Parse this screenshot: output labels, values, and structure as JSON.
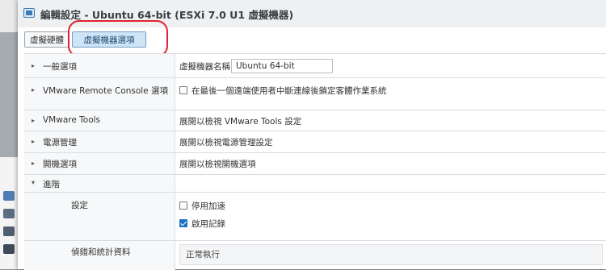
{
  "dialog": {
    "title": "編輯設定 - Ubuntu 64-bit (ESXi 7.0 U1 虛擬機器)",
    "tabs": [
      {
        "label": "虛擬硬體",
        "active": false
      },
      {
        "label": "虛擬機器選項",
        "active": true
      }
    ]
  },
  "rows": {
    "general": {
      "label": "一般選項",
      "name_label": "虛擬機器名稱:",
      "name_value": "Ubuntu 64-bit"
    },
    "vmrc": {
      "label": "VMware Remote Console 選項",
      "checkbox_label": "在最後一個遠端使用者中斷連線後鎖定客體作業系統",
      "checked": false
    },
    "tools": {
      "label": "VMware Tools",
      "value": "展開以檢視 VMware Tools 設定"
    },
    "power": {
      "label": "電源管理",
      "value": "展開以檢視電源管理設定"
    },
    "boot": {
      "label": "開機選項",
      "value": "展開以檢視開機選項"
    },
    "advanced": {
      "label": "進階",
      "settings_label": "設定",
      "options": [
        {
          "label": "停用加速",
          "checked": false
        },
        {
          "label": "啟用記錄",
          "checked": true
        }
      ],
      "debug_label": "偵錯和統計資料",
      "debug_value": "正常執行"
    }
  },
  "colors": {
    "accent": "#1e72c7",
    "highlight": "#e0222e",
    "active_tab": "#cfe4f6"
  },
  "icons": {
    "caret_right": "▸",
    "caret_down": "▾"
  }
}
